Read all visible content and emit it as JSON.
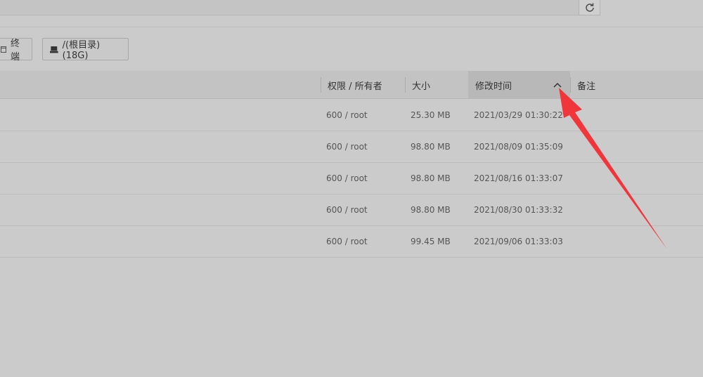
{
  "toolbar": {
    "terminal_label": "终端",
    "root_label": "/(根目录) (18G)"
  },
  "table": {
    "headers": {
      "perm": "权限 / 所有者",
      "size": "大小",
      "mtime": "修改时间",
      "note": "备注"
    },
    "sort": {
      "column": "mtime",
      "direction": "asc"
    },
    "rows": [
      {
        "perm": "600 / root",
        "size": "25.30 MB",
        "mtime": "2021/03/29 01:30:22",
        "note": ""
      },
      {
        "perm": "600 / root",
        "size": "98.80 MB",
        "mtime": "2021/08/09 01:35:09",
        "note": ""
      },
      {
        "perm": "600 / root",
        "size": "98.80 MB",
        "mtime": "2021/08/16 01:33:07",
        "note": ""
      },
      {
        "perm": "600 / root",
        "size": "98.80 MB",
        "mtime": "2021/08/30 01:33:32",
        "note": ""
      },
      {
        "perm": "600 / root",
        "size": "99.45 MB",
        "mtime": "2021/09/06 01:33:03",
        "note": ""
      }
    ]
  },
  "colors": {
    "background": "#cbcbcb",
    "header_bg": "#c3c3c3",
    "active_header_bg": "#b8b8b8",
    "annotation_arrow": "#f0353b"
  },
  "icons": {
    "refresh": "refresh-icon",
    "terminal": "terminal-icon",
    "disk": "disk-icon",
    "sort": "chevron-up-icon"
  }
}
